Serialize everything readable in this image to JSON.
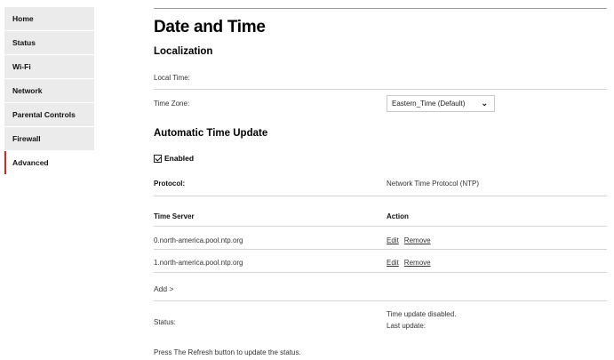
{
  "sidebar": {
    "items": [
      {
        "label": "Home"
      },
      {
        "label": "Status"
      },
      {
        "label": "Wi-Fi"
      },
      {
        "label": "Network"
      },
      {
        "label": "Parental Controls"
      },
      {
        "label": "Firewall"
      },
      {
        "label": "Advanced"
      }
    ],
    "active_item": "Advanced"
  },
  "page": {
    "title": "Date and Time",
    "localization": {
      "title": "Localization",
      "local_time_label": "Local Time:",
      "time_zone_label": "Time Zone:",
      "time_zone_value": "Eastern_Time (Default)"
    },
    "auto_update": {
      "title": "Automatic Time Update",
      "enabled_label": "Enabled",
      "enabled": true,
      "protocol_label": "Protocol:",
      "protocol_value": "Network Time Protocol (NTP)",
      "table": {
        "col_server": "Time Server",
        "col_action": "Action",
        "rows": [
          {
            "server": "0.north-america.pool.ntp.org",
            "edit": "Edit",
            "remove": "Remove"
          },
          {
            "server": "1.north-america.pool.ntp.org",
            "edit": "Edit",
            "remove": "Remove"
          }
        ]
      },
      "add_label": "Add >",
      "status_label": "Status:",
      "status_line1": "Time update disabled.",
      "status_line2": "Last update:",
      "refresh_note": "Press The Refresh button to update the status."
    }
  },
  "colors": {
    "accent": "#d52b1e",
    "nav_bg": "#ebebeb"
  }
}
